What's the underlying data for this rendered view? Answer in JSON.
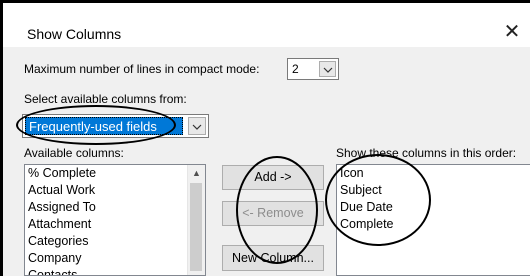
{
  "window": {
    "title": "Show Columns",
    "close_glyph": "✕"
  },
  "compact": {
    "label": "Maximum number of lines in compact mode:",
    "value": "2"
  },
  "source": {
    "label": "Select available columns from:",
    "selected": "Frequently-used fields"
  },
  "available": {
    "label": "Available columns:",
    "items": [
      "% Complete",
      "Actual Work",
      "Assigned To",
      "Attachment",
      "Categories",
      "Company",
      "Contacts"
    ]
  },
  "buttons": {
    "add": "Add ->",
    "remove": "<- Remove",
    "new_column": "New Column..."
  },
  "shown": {
    "label": "Show these columns in this order:",
    "items": [
      "Icon",
      "Subject",
      "Due Date",
      "Complete"
    ]
  },
  "colors": {
    "selection": "#0078d7",
    "dialog_bg": "#f0f0f0",
    "annotation": "#000000"
  }
}
